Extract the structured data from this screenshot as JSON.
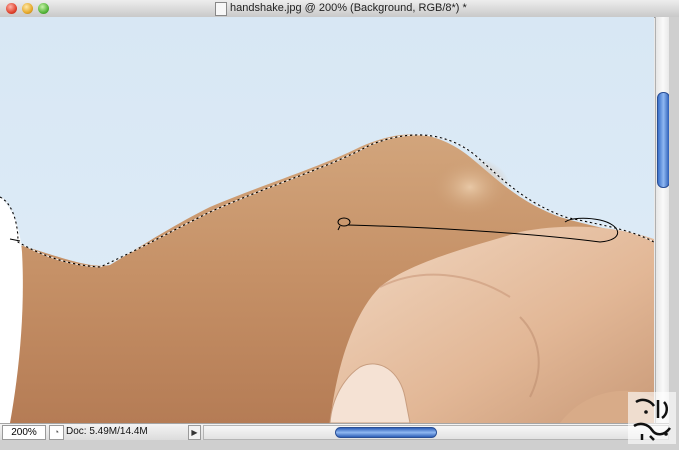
{
  "window": {
    "title": "handshake.jpg @ 200% (Background, RGB/8*) *"
  },
  "status": {
    "zoom": "200%",
    "doc_size": "Doc: 5.49M/14.4M"
  },
  "icons": {
    "close": "close-icon",
    "minimize": "minimize-icon",
    "maximize": "maximize-icon",
    "document": "document-icon",
    "preview": "preview-icon",
    "arrow": "arrow-right-icon"
  },
  "colors": {
    "sky": "#dbe9f5",
    "skin": "#c99a70",
    "thumb_blue": "#3a6fc8"
  }
}
